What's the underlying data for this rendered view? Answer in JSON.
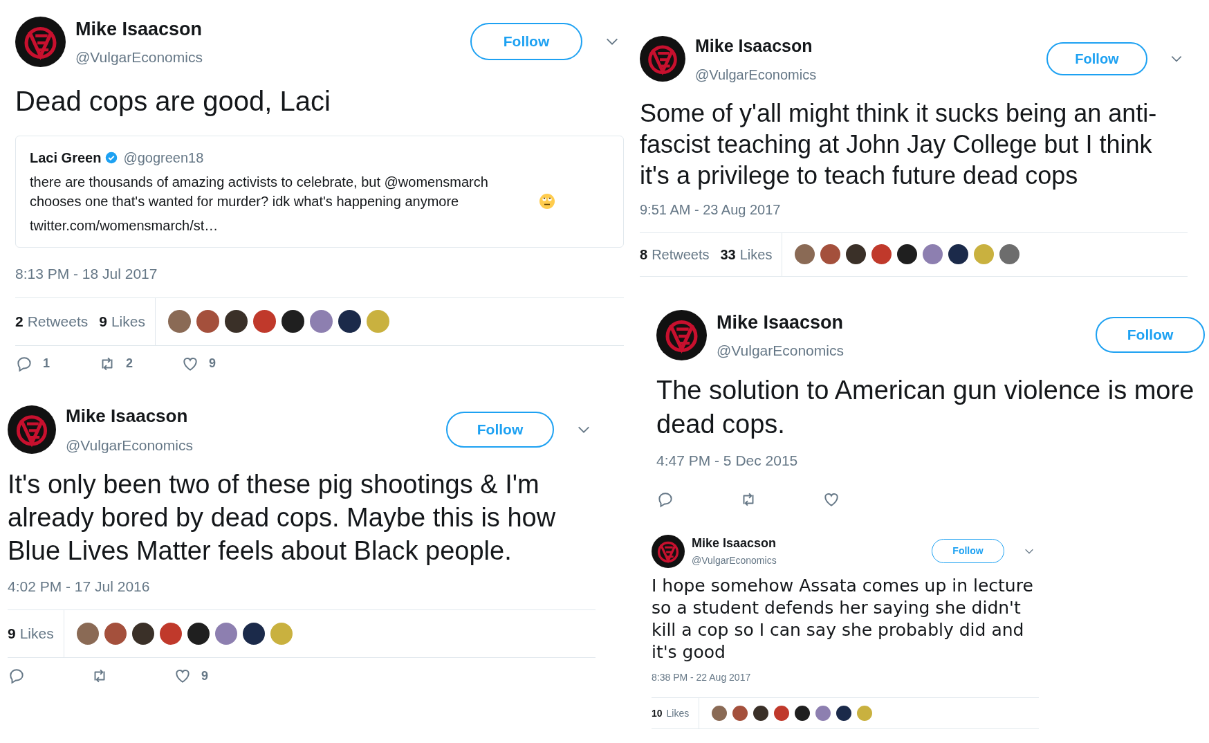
{
  "tweets": [
    {
      "name": "Mike Isaacson",
      "handle": "@VulgarEconomics",
      "follow": "Follow",
      "text": "Dead cops are good, Laci",
      "quote": {
        "name": "Laci Green",
        "verified": true,
        "handle": "@gogreen18",
        "text": "there are thousands of amazing activists to celebrate, but @womensmarch chooses one that's wanted for murder? idk what's happening anymore",
        "link": "twitter.com/womensmarch/st…"
      },
      "timestamp": "8:13 PM - 18 Jul 2017",
      "stats": [
        {
          "count": "2",
          "label": "Retweets"
        },
        {
          "count": "9",
          "label": "Likes"
        }
      ],
      "actions": [
        {
          "kind": "reply",
          "count": "1"
        },
        {
          "kind": "retweet",
          "count": "2"
        },
        {
          "kind": "like",
          "count": "9"
        }
      ]
    },
    {
      "name": "Mike Isaacson",
      "handle": "@VulgarEconomics",
      "follow": "Follow",
      "text": "It's only been two of these pig shootings & I'm already bored by dead cops. Maybe this is how Blue Lives Matter feels about Black people.",
      "timestamp": "4:02 PM - 17 Jul 2016",
      "stats": [
        {
          "count": "9",
          "label": "Likes"
        }
      ],
      "actions": [
        {
          "kind": "reply"
        },
        {
          "kind": "retweet"
        },
        {
          "kind": "like",
          "count": "9"
        }
      ]
    },
    {
      "name": "Mike Isaacson",
      "handle": "@VulgarEconomics",
      "follow": "Follow",
      "text": "Some of y'all might think it sucks being an anti-fascist teaching at John Jay College but I think it's a privilege to teach future dead cops",
      "timestamp": "9:51 AM - 23 Aug 2017",
      "stats": [
        {
          "count": "8",
          "label": "Retweets"
        },
        {
          "count": "33",
          "label": "Likes"
        }
      ]
    },
    {
      "name": "Mike Isaacson",
      "handle": "@VulgarEconomics",
      "follow": "Follow",
      "text": "The solution to American gun violence is more dead cops.",
      "timestamp": "4:47 PM - 5 Dec 2015",
      "actions": [
        {
          "kind": "reply"
        },
        {
          "kind": "retweet"
        },
        {
          "kind": "like"
        }
      ]
    },
    {
      "name": "Mike Isaacson",
      "handle": "@VulgarEconomics",
      "follow": "Follow",
      "text": "I hope somehow Assata comes up in lecture so a student defends her saying she didn't kill a cop so I can say she probably did and it's good",
      "timestamp": "8:38 PM - 22 Aug 2017",
      "stats": [
        {
          "count": "10",
          "label": "Likes"
        }
      ]
    }
  ]
}
